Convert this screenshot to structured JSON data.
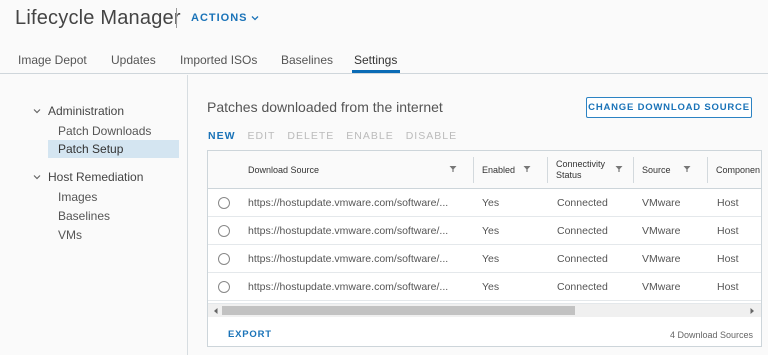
{
  "header": {
    "app_title": "Lifecycle Manager",
    "actions_label": "ACTIONS",
    "actions_icon": "chevron-down-icon"
  },
  "tabs": [
    {
      "label": "Image Depot",
      "active": false
    },
    {
      "label": "Updates",
      "active": false
    },
    {
      "label": "Imported ISOs",
      "active": false
    },
    {
      "label": "Baselines",
      "active": false
    },
    {
      "label": "Settings",
      "active": true
    }
  ],
  "sidebar": {
    "groups": [
      {
        "label": "Administration",
        "expanded": true,
        "items": [
          {
            "label": "Patch Downloads",
            "selected": false
          },
          {
            "label": "Patch Setup",
            "selected": true
          }
        ]
      },
      {
        "label": "Host Remediation",
        "expanded": true,
        "items": [
          {
            "label": "Images",
            "selected": false
          },
          {
            "label": "Baselines",
            "selected": false
          },
          {
            "label": "VMs",
            "selected": false
          }
        ]
      }
    ]
  },
  "panel": {
    "title": "Patches downloaded from the internet",
    "change_source_label": "CHANGE DOWNLOAD SOURCE"
  },
  "toolbar": {
    "new": "NEW",
    "edit": "EDIT",
    "delete": "DELETE",
    "enable": "ENABLE",
    "disable": "DISABLE"
  },
  "grid": {
    "columns": [
      "Download Source",
      "Enabled",
      "Connectivity Status",
      "Source",
      "Componen"
    ],
    "rows": [
      {
        "source": "https://hostupdate.vmware.com/software/...",
        "enabled": "Yes",
        "status": "Connected",
        "origin": "VMware",
        "component": "Host"
      },
      {
        "source": "https://hostupdate.vmware.com/software/...",
        "enabled": "Yes",
        "status": "Connected",
        "origin": "VMware",
        "component": "Host"
      },
      {
        "source": "https://hostupdate.vmware.com/software/...",
        "enabled": "Yes",
        "status": "Connected",
        "origin": "VMware",
        "component": "Host"
      },
      {
        "source": "https://hostupdate.vmware.com/software/...",
        "enabled": "Yes",
        "status": "Connected",
        "origin": "VMware",
        "component": "Host"
      }
    ],
    "export_label": "EXPORT",
    "footer_count": "4 Download Sources"
  },
  "colors": {
    "accent": "#1a73b8",
    "selection": "#d4e5f1",
    "tab_underline": "#0a6bb5"
  }
}
